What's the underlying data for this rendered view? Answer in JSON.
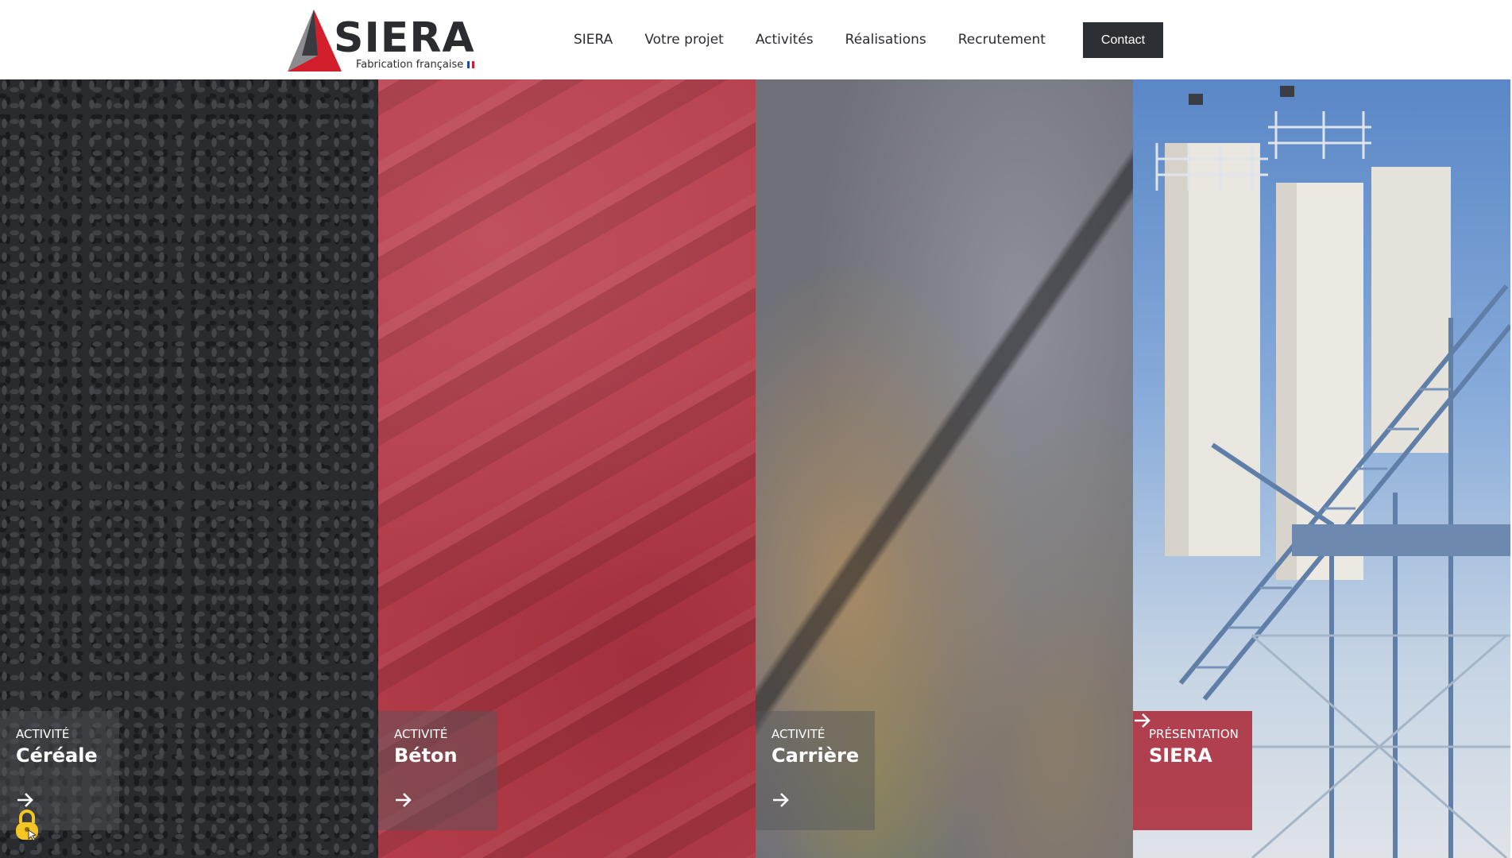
{
  "header": {
    "logo_word": "SIERA",
    "logo_tagline": "Fabrication française",
    "nav": [
      {
        "label": "SIERA"
      },
      {
        "label": "Votre projet"
      },
      {
        "label": "Activités"
      },
      {
        "label": "Réalisations"
      },
      {
        "label": "Recrutement"
      }
    ],
    "contact_label": "Contact"
  },
  "panels": [
    {
      "kicker": "ACTIVITÉ",
      "title": "Céréale",
      "texture": "black-grain"
    },
    {
      "kicker": "ACTIVITÉ",
      "title": "Béton",
      "texture": "red-powder"
    },
    {
      "kicker": "ACTIVITÉ",
      "title": "Carrière",
      "texture": "grey-rock"
    },
    {
      "kicker": "PRÉSENTATION",
      "title": "SIERA",
      "texture": "silo-plant"
    }
  ],
  "icons": {
    "arrow": "arrow-right-icon",
    "lock": "lock-icon",
    "flag": "french-flag-icon"
  },
  "colors": {
    "brand_red": "#d21f2b",
    "brand_dark": "#2b2c30",
    "contact_bg": "#2c2f33",
    "highlight_caption": "#aa2434"
  }
}
